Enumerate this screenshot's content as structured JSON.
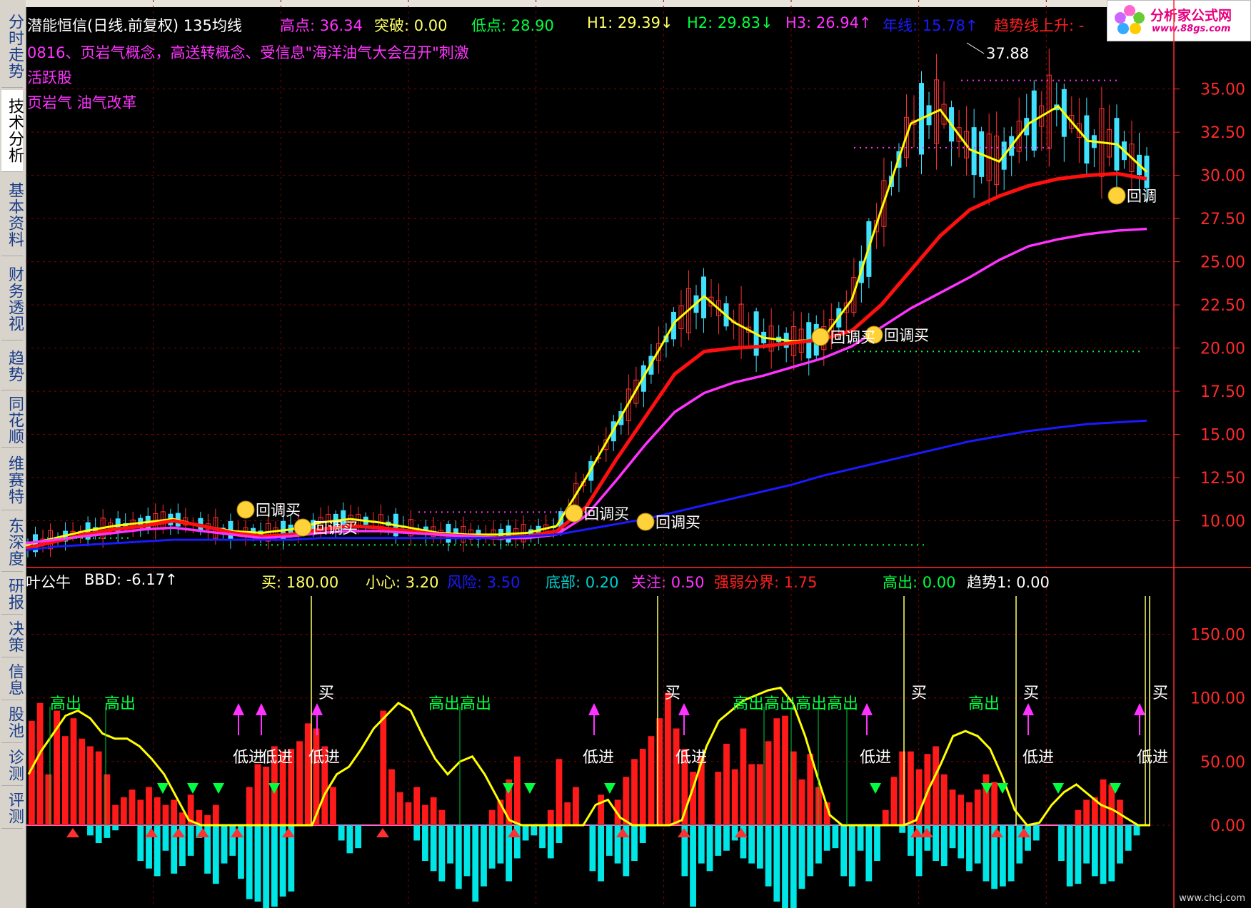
{
  "sidebar": {
    "tabs": [
      {
        "label": "分时走势",
        "active": false
      },
      {
        "label": "技术分析",
        "active": true
      },
      {
        "label": "基本资料",
        "active": false
      },
      {
        "label": "财务透视",
        "active": false
      },
      {
        "label": "趋势",
        "active": false
      },
      {
        "label": "同花顺",
        "active": false
      },
      {
        "label": "维赛特",
        "active": false
      },
      {
        "label": "东深度",
        "active": false
      },
      {
        "label": "研报",
        "active": false
      },
      {
        "label": "决策",
        "active": false
      },
      {
        "label": "信息",
        "active": false
      },
      {
        "label": "股池",
        "active": false
      },
      {
        "label": "诊测",
        "active": false
      },
      {
        "label": "评测",
        "active": false
      }
    ]
  },
  "menu": {
    "items": [
      "",
      "",
      "",
      "",
      "",
      "",
      "",
      "",
      "",
      "",
      "",
      "",
      "",
      "",
      "",
      ""
    ]
  },
  "logo": {
    "title": "分析家公式网",
    "subtitle": "www.88gs.com"
  },
  "header": {
    "stock_title": "潜能恒信(日线.前复权) 135均线",
    "high_label": "高点: 36.34",
    "break_label": "突破: 0.00",
    "low_label": "低点: 28.90",
    "h1_label": "H1: 29.39↓",
    "h2_label": "H2: 29.83↓",
    "h3_label": "H3: 26.94↑",
    "year_line_label": "年线: 15.78↑",
    "trend_label": "趋势线上升: -"
  },
  "notes": {
    "line1": "0816、页岩气概念，高送转概念、受信息\"海洋油气大会召开\"刺激",
    "line2": "活跃股",
    "line3": "页岩气 油气改革"
  },
  "lower_header": {
    "name": "叶公牛",
    "bbd": "BBD: -6.17↑",
    "buy": "买: 180.00",
    "careful": "小心: 3.20",
    "risk": "风险: 3.50",
    "bottom": "底部: 0.20",
    "watch": "关注: 0.50",
    "strength": "强弱分界: 1.75",
    "high_out": "高出: 0.00",
    "trend1": "趋势1: 0.00"
  },
  "colors": {
    "yellow": "#ffff00",
    "red": "#ff1010",
    "magenta": "#ff33ff",
    "blue": "#1a1aff",
    "cyan": "#00e5e5",
    "green": "#00ff40",
    "grid": "#8b0000",
    "axis": "#ff2a2a"
  },
  "chart_data": [
    {
      "type": "candlestick",
      "title": "潜能恒信(日线.前复权) 135均线",
      "ylim": [
        7.5,
        38.5
      ],
      "y_ticks": [
        10.0,
        12.5,
        15.0,
        17.5,
        20.0,
        22.5,
        25.0,
        27.5,
        30.0,
        32.5,
        35.0
      ],
      "y_tick_labels": [
        "10.00",
        "12.50",
        "15.00",
        "17.50",
        "20.00",
        "22.50",
        "25.00",
        "27.50",
        "30.00",
        "32.50",
        "35.00"
      ],
      "peak_label": "37.88",
      "series": [
        {
          "name": "yellow_ma",
          "color": "#ffff00",
          "values": [
            8.6,
            9.0,
            9.4,
            9.7,
            9.9,
            10.1,
            9.7,
            9.4,
            9.3,
            9.5,
            9.9,
            10.1,
            9.9,
            9.6,
            9.3,
            9.2,
            9.2,
            9.3,
            9.7,
            12.5,
            15.5,
            18.5,
            21.5,
            23.0,
            21.5,
            20.6,
            20.4,
            20.5,
            22.8,
            28.0,
            33.0,
            33.8,
            31.5,
            30.8,
            33.0,
            34.0,
            32.0,
            31.8,
            30.2
          ]
        },
        {
          "name": "red_ma",
          "color": "#ff1010",
          "values": [
            8.4,
            8.8,
            9.2,
            9.5,
            9.7,
            10.0,
            9.7,
            9.3,
            9.1,
            9.2,
            9.5,
            9.7,
            9.6,
            9.4,
            9.2,
            9.1,
            9.0,
            9.1,
            9.4,
            10.8,
            13.5,
            16.0,
            18.5,
            19.8,
            20.0,
            20.1,
            20.3,
            20.5,
            21.0,
            22.5,
            24.5,
            26.5,
            28.0,
            28.8,
            29.4,
            29.8,
            30.0,
            30.1,
            29.8
          ]
        },
        {
          "name": "magenta_ma",
          "color": "#ff33ff",
          "values": [
            8.7,
            8.9,
            9.1,
            9.3,
            9.5,
            9.6,
            9.4,
            9.2,
            9.0,
            9.1,
            9.3,
            9.4,
            9.4,
            9.3,
            9.2,
            9.1,
            9.0,
            9.0,
            9.2,
            10.3,
            12.3,
            14.4,
            16.3,
            17.4,
            18.0,
            18.4,
            18.9,
            19.4,
            20.1,
            21.2,
            22.3,
            23.2,
            24.1,
            25.1,
            25.9,
            26.3,
            26.6,
            26.8,
            26.9
          ]
        },
        {
          "name": "blue_year",
          "color": "#1a1aff",
          "values": [
            8.3,
            8.5,
            8.6,
            8.7,
            8.8,
            8.9,
            8.9,
            8.9,
            8.9,
            8.9,
            9.0,
            9.0,
            9.0,
            9.0,
            9.0,
            9.0,
            9.0,
            9.1,
            9.2,
            9.5,
            9.8,
            10.1,
            10.5,
            10.9,
            11.3,
            11.7,
            12.1,
            12.6,
            13.0,
            13.4,
            13.8,
            14.2,
            14.6,
            14.9,
            15.2,
            15.4,
            15.6,
            15.7,
            15.8
          ]
        }
      ],
      "annotations": [
        "回调买",
        "回调买",
        "回调买",
        "回调买",
        "回调买",
        "回调买",
        "回调"
      ]
    },
    {
      "type": "bar",
      "title": "叶公牛",
      "ylim": [
        -65,
        180
      ],
      "y_ticks": [
        0,
        50,
        100,
        150
      ],
      "y_tick_labels": [
        "0.00",
        "50.00",
        "100.00",
        "150.00"
      ],
      "red_bars": [
        82,
        96,
        40,
        90,
        70,
        84,
        68,
        62,
        58,
        40,
        16,
        22,
        28,
        20,
        30,
        22,
        16,
        20,
        10,
        24,
        12,
        8,
        16,
        0,
        0,
        0,
        30,
        48,
        46,
        62,
        58,
        60,
        66,
        80,
        76,
        62,
        30,
        0,
        0,
        0,
        0,
        0,
        90,
        44,
        26,
        18,
        30,
        16,
        22,
        12,
        0,
        0,
        0,
        0,
        0,
        12,
        20,
        36,
        54,
        0,
        0,
        0,
        12,
        52,
        18,
        30,
        0,
        0,
        24,
        0,
        20,
        38,
        52,
        60,
        70,
        84,
        104,
        76,
        60,
        42,
        54,
        0,
        42,
        64,
        44,
        76,
        48,
        48,
        66,
        84,
        86,
        58,
        36,
        56,
        30,
        18,
        0,
        0,
        0,
        0,
        0,
        0,
        12,
        38,
        58,
        58,
        44,
        56,
        62,
        40,
        28,
        24,
        18,
        28,
        40,
        34,
        0,
        0,
        0,
        0,
        0,
        0,
        0,
        0,
        0,
        12,
        20,
        22,
        36,
        32,
        20,
        0,
        0,
        0
      ],
      "cyan_bars": [
        0,
        0,
        0,
        0,
        0,
        0,
        0,
        -8,
        -14,
        -10,
        -4,
        0,
        0,
        -28,
        -34,
        -40,
        -20,
        -38,
        -32,
        -24,
        -10,
        -38,
        -46,
        -30,
        -24,
        -42,
        -58,
        -60,
        -68,
        -64,
        -56,
        -52,
        0,
        0,
        0,
        0,
        0,
        -12,
        -22,
        -18,
        0,
        0,
        0,
        0,
        0,
        0,
        -12,
        -28,
        -36,
        -44,
        -30,
        -50,
        -40,
        -60,
        -48,
        -34,
        -30,
        -44,
        -26,
        -12,
        -8,
        -18,
        -26,
        -14,
        0,
        0,
        0,
        -36,
        -44,
        -24,
        -30,
        -40,
        -28,
        -14,
        0,
        0,
        0,
        0,
        -40,
        -64,
        -30,
        -36,
        -24,
        -20,
        -12,
        -26,
        -30,
        -34,
        -48,
        -60,
        -70,
        -66,
        -50,
        -40,
        -30,
        -20,
        -18,
        -40,
        -48,
        -20,
        -44,
        -28,
        0,
        0,
        -6,
        -24,
        -40,
        -20,
        -28,
        -32,
        -18,
        -26,
        -36,
        -30,
        -44,
        -50,
        -48,
        -44,
        -30,
        -20,
        -12,
        0,
        0,
        -28,
        -48,
        -46,
        -30,
        -40,
        -46,
        -44,
        -30,
        -20,
        -8
      ],
      "yellow_line": [
        40,
        58,
        72,
        86,
        90,
        84,
        72,
        68,
        68,
        62,
        52,
        40,
        22,
        4,
        0,
        0,
        0,
        0,
        0,
        0,
        0,
        0,
        0,
        0,
        24,
        40,
        46,
        60,
        76,
        86,
        96,
        90,
        70,
        52,
        40,
        50,
        54,
        40,
        22,
        4,
        0,
        0,
        0,
        0,
        0,
        0,
        16,
        20,
        6,
        0,
        0,
        0,
        0,
        4,
        32,
        62,
        82,
        90,
        98,
        102,
        106,
        108,
        96,
        70,
        38,
        8,
        0,
        0,
        0,
        0,
        0,
        0,
        4,
        28,
        48,
        70,
        74,
        70,
        60,
        38,
        12,
        0,
        2,
        16,
        26,
        32,
        24,
        16,
        12,
        6,
        0,
        0
      ],
      "labels_high": [
        "高出",
        "高出",
        "高出高出",
        "高出高出高出高出",
        "高出"
      ],
      "labels_low": [
        "低进",
        "低进",
        "低进",
        "低进",
        "低进",
        "低进",
        "低进",
        "低进"
      ],
      "labels_buy": [
        "买",
        "买",
        "买",
        "买",
        "买"
      ]
    }
  ],
  "watermark": "www.chcj.com"
}
